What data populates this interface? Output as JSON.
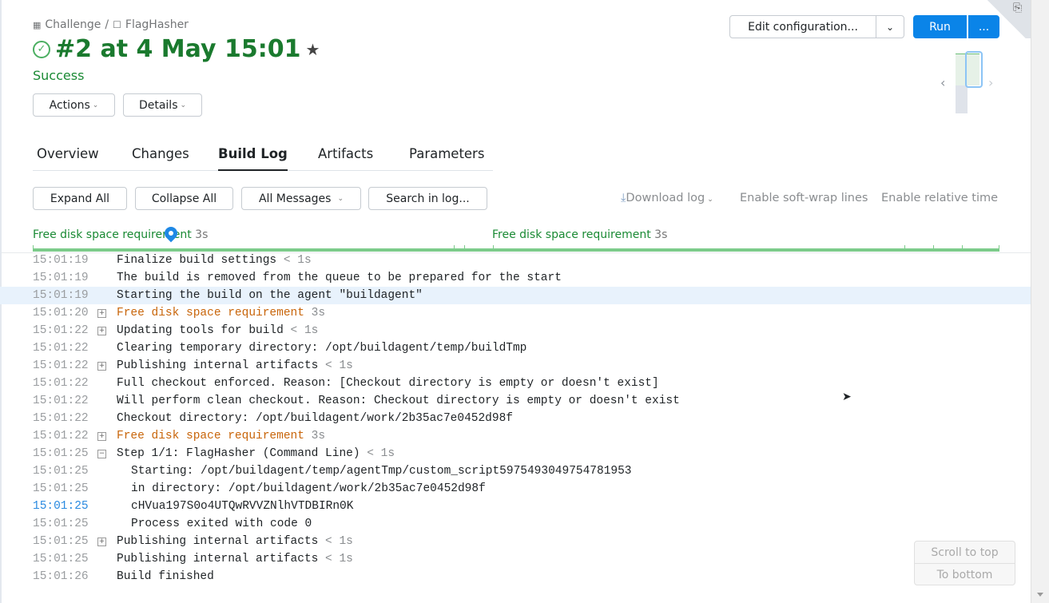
{
  "breadcrumb": {
    "project": "Challenge",
    "separator": "/",
    "config": "FlagHasher"
  },
  "build": {
    "title": "#2 at 4 May 15:01",
    "status": "Success"
  },
  "buttons": {
    "actions": "Actions",
    "details": "Details",
    "edit_config": "Edit configuration...",
    "run": "Run",
    "more": "..."
  },
  "tabs": [
    "Overview",
    "Changes",
    "Build Log",
    "Artifacts",
    "Parameters"
  ],
  "toolbar": {
    "expand_all": "Expand All",
    "collapse_all": "Collapse All",
    "all_messages": "All Messages",
    "search": "Search in log...",
    "download_log": "Download log",
    "soft_wrap": "Enable soft-wrap lines",
    "relative_time": "Enable relative time"
  },
  "timeline": [
    {
      "label": "Free disk space requirement",
      "dur": "3s"
    },
    {
      "label": "Free disk space requirement",
      "dur": "3s"
    }
  ],
  "log": [
    {
      "time": "15:01:19",
      "toggle": "",
      "text": "Finalize build settings",
      "suffix": " < 1s"
    },
    {
      "time": "15:01:19",
      "toggle": "",
      "text": "The build is removed from the queue to be prepared for the start",
      "suffix": ""
    },
    {
      "time": "15:01:19",
      "toggle": "",
      "text": "Starting the build on the agent \"buildagent\"",
      "suffix": "",
      "highlight": true
    },
    {
      "time": "15:01:20",
      "toggle": "+",
      "text": "Free disk space requirement",
      "suffix": " 3s",
      "orange": true
    },
    {
      "time": "15:01:22",
      "toggle": "+",
      "text": "Updating tools for build",
      "suffix": " < 1s"
    },
    {
      "time": "15:01:22",
      "toggle": "",
      "text": "Clearing temporary directory: /opt/buildagent/temp/buildTmp",
      "suffix": ""
    },
    {
      "time": "15:01:22",
      "toggle": "+",
      "text": "Publishing internal artifacts",
      "suffix": " < 1s"
    },
    {
      "time": "15:01:22",
      "toggle": "",
      "text": "Full checkout enforced. Reason: [Checkout directory is empty or doesn't exist]",
      "suffix": ""
    },
    {
      "time": "15:01:22",
      "toggle": "",
      "text": "Will perform clean checkout. Reason: Checkout directory is empty or doesn't exist",
      "suffix": ""
    },
    {
      "time": "15:01:22",
      "toggle": "",
      "text": "Checkout directory: /opt/buildagent/work/2b35ac7e0452d98f",
      "suffix": ""
    },
    {
      "time": "15:01:22",
      "toggle": "+",
      "text": "Free disk space requirement",
      "suffix": " 3s",
      "orange": true
    },
    {
      "time": "15:01:25",
      "toggle": "−",
      "text": "Step 1/1: FlagHasher (Command Line)",
      "suffix": " < 1s"
    },
    {
      "time": "15:01:25",
      "toggle": "",
      "text": "Starting: /opt/buildagent/temp/agentTmp/custom_script5975493049754781953",
      "suffix": "",
      "indent": true
    },
    {
      "time": "15:01:25",
      "toggle": "",
      "text": "in directory: /opt/buildagent/work/2b35ac7e0452d98f",
      "suffix": "",
      "indent": true
    },
    {
      "time": "15:01:25",
      "toggle": "",
      "text": "cHVua197S0o4UTQwRVVZNlhVTDBIRn0K",
      "suffix": "",
      "indent": true,
      "blue_time": true
    },
    {
      "time": "15:01:25",
      "toggle": "",
      "text": "Process exited with code 0",
      "suffix": "",
      "indent": true
    },
    {
      "time": "15:01:25",
      "toggle": "+",
      "text": "Publishing internal artifacts",
      "suffix": " < 1s"
    },
    {
      "time": "15:01:25",
      "toggle": "",
      "text": "Publishing internal artifacts",
      "suffix": " < 1s"
    },
    {
      "time": "15:01:26",
      "toggle": "",
      "text": "Build finished",
      "suffix": ""
    }
  ],
  "scroll": {
    "top": "Scroll to top",
    "bottom": "To bottom"
  }
}
